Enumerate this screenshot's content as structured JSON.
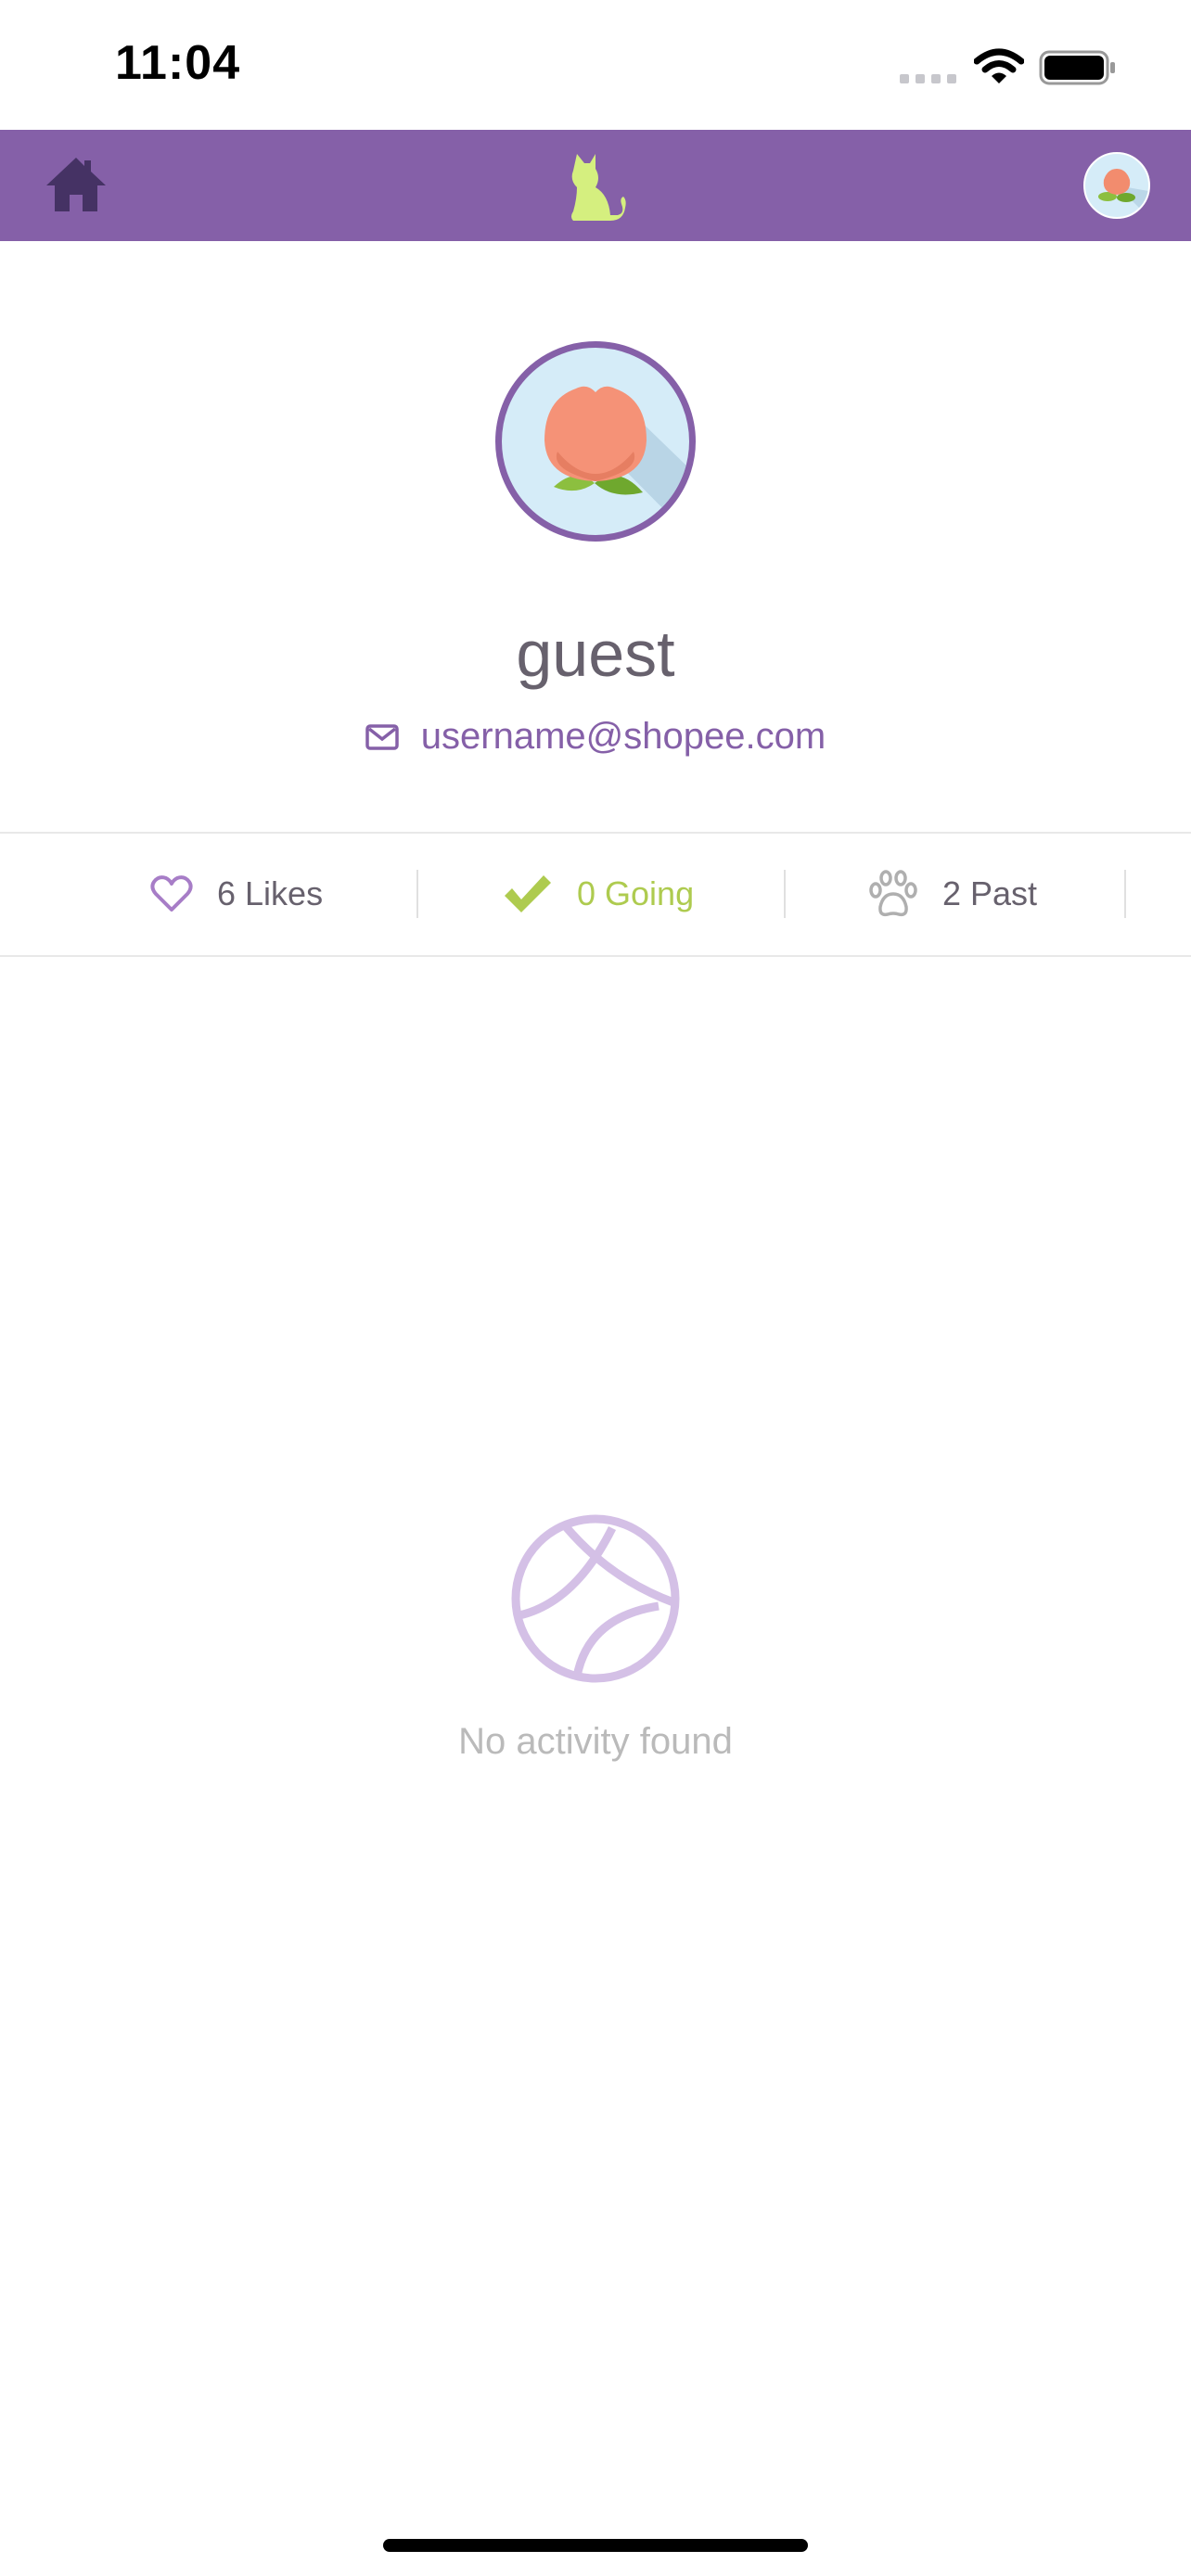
{
  "status_bar": {
    "time": "11:04"
  },
  "nav": {
    "home_icon": "home-icon",
    "logo_icon": "cat-logo-icon",
    "avatar_icon": "peach-avatar-icon",
    "bar_color": "#8560A8",
    "logo_color": "#D5EF7F"
  },
  "profile": {
    "name": "guest",
    "email": "username@shopee.com",
    "email_icon": "mail-icon"
  },
  "stats": [
    {
      "icon": "heart-icon",
      "label": "6 Likes",
      "color": "#67616D"
    },
    {
      "icon": "check-icon",
      "label": "0 Going",
      "color": "#AECB4F"
    },
    {
      "icon": "paw-icon",
      "label": "2 Past",
      "color": "#67616D"
    }
  ],
  "empty_state": {
    "icon": "ball-icon",
    "message": "No activity found"
  }
}
